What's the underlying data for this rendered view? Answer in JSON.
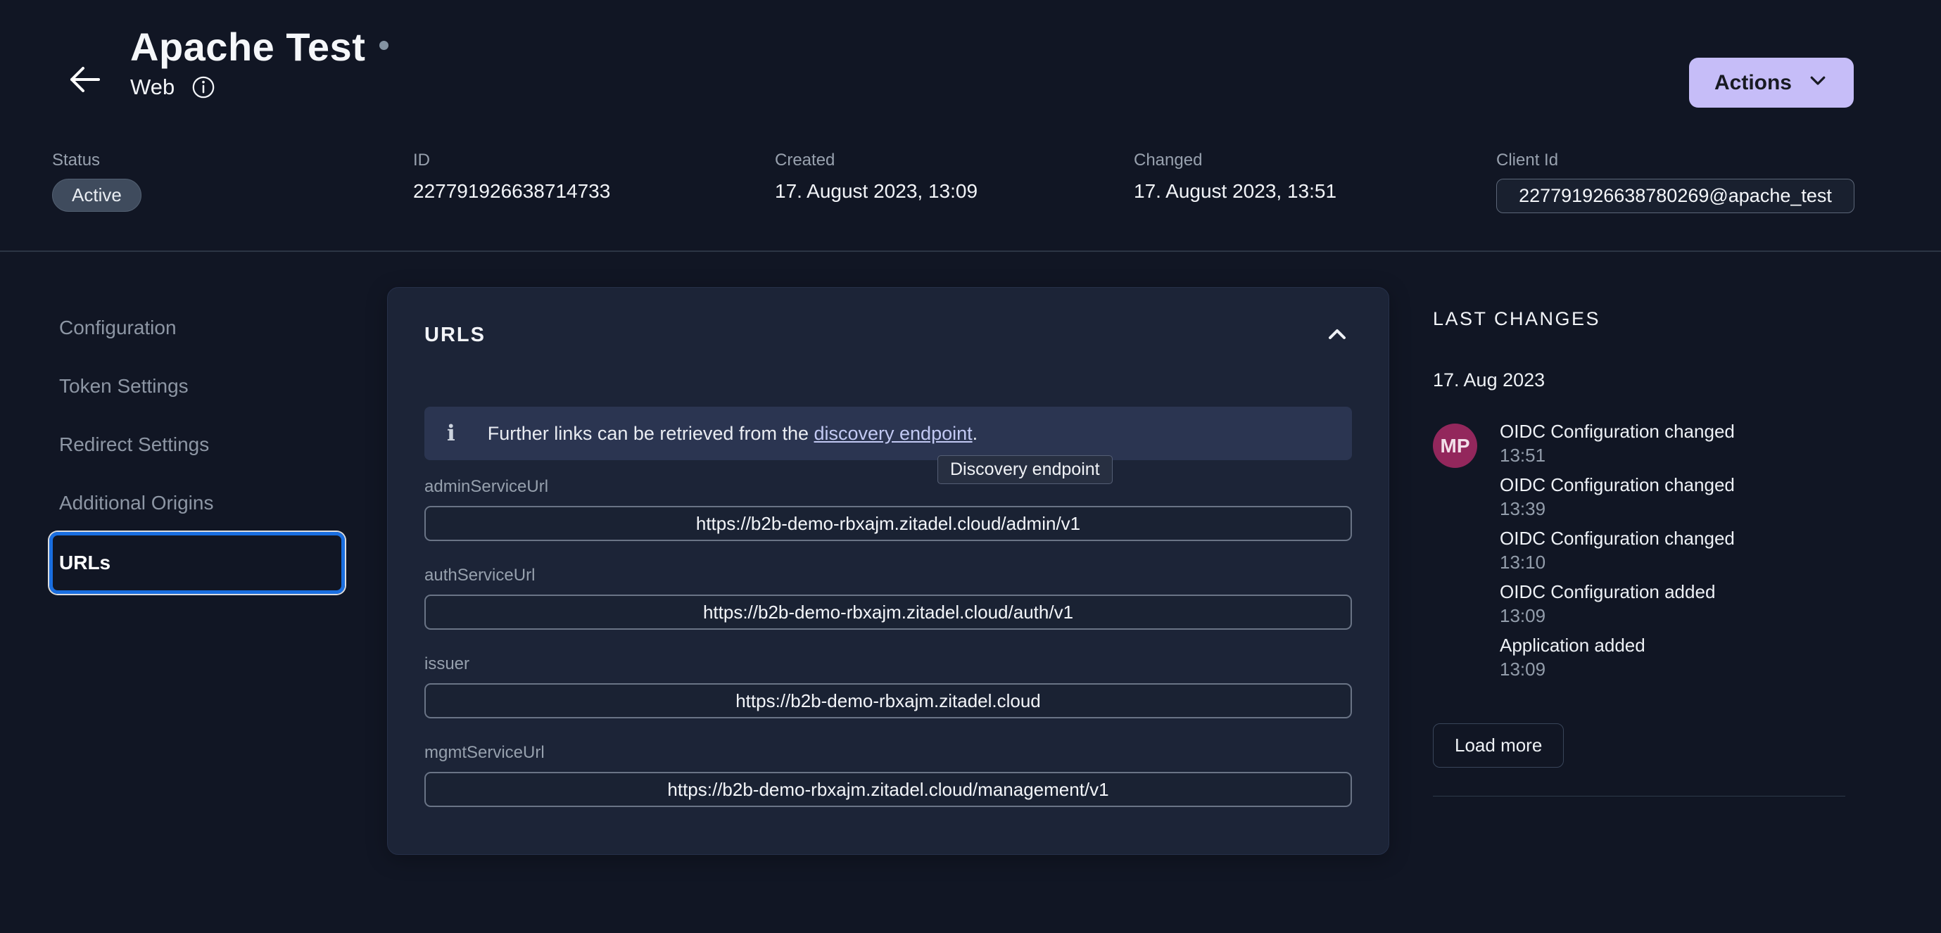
{
  "header": {
    "title": "Apache Test",
    "subtitle": "Web",
    "actions_label": "Actions"
  },
  "meta": {
    "status": {
      "label": "Status",
      "value": "Active"
    },
    "id": {
      "label": "ID",
      "value": "227791926638714733"
    },
    "created": {
      "label": "Created",
      "value": "17. August 2023, 13:09"
    },
    "changed": {
      "label": "Changed",
      "value": "17. August 2023, 13:51"
    },
    "client_id": {
      "label": "Client Id",
      "value": "227791926638780269@apache_test"
    }
  },
  "nav": {
    "items": [
      {
        "label": "Configuration",
        "selected": false
      },
      {
        "label": "Token Settings",
        "selected": false
      },
      {
        "label": "Redirect Settings",
        "selected": false
      },
      {
        "label": "Additional Origins",
        "selected": false
      },
      {
        "label": "URLs",
        "selected": true
      }
    ]
  },
  "card": {
    "title": "URLS",
    "banner": {
      "text_before_link": "Further links can be retrieved from the ",
      "link_text": "discovery endpoint",
      "text_after_link": "."
    },
    "tooltip": "Discovery endpoint",
    "fields": [
      {
        "label": "adminServiceUrl",
        "value": "https://b2b-demo-rbxajm.zitadel.cloud/admin/v1"
      },
      {
        "label": "authServiceUrl",
        "value": "https://b2b-demo-rbxajm.zitadel.cloud/auth/v1"
      },
      {
        "label": "issuer",
        "value": "https://b2b-demo-rbxajm.zitadel.cloud"
      },
      {
        "label": "mgmtServiceUrl",
        "value": "https://b2b-demo-rbxajm.zitadel.cloud/management/v1"
      }
    ]
  },
  "changes": {
    "title": "LAST CHANGES",
    "date": "17. Aug 2023",
    "avatar_initials": "MP",
    "events": [
      {
        "title": "OIDC Configuration changed",
        "time": "13:51"
      },
      {
        "title": "OIDC Configuration changed",
        "time": "13:39"
      },
      {
        "title": "OIDC Configuration changed",
        "time": "13:10"
      },
      {
        "title": "OIDC Configuration added",
        "time": "13:09"
      },
      {
        "title": "Application added",
        "time": "13:09"
      }
    ],
    "load_more_label": "Load more"
  },
  "colors": {
    "page_background": "#111624",
    "card_background": "#1c2437",
    "banner_background": "#2b3551",
    "accent_button": "#c6bdf8",
    "nav_selected_border": "#1a6ee0",
    "avatar_background": "#93275c",
    "link": "#c2c9f3",
    "badge_background": "#3f4b5d"
  }
}
